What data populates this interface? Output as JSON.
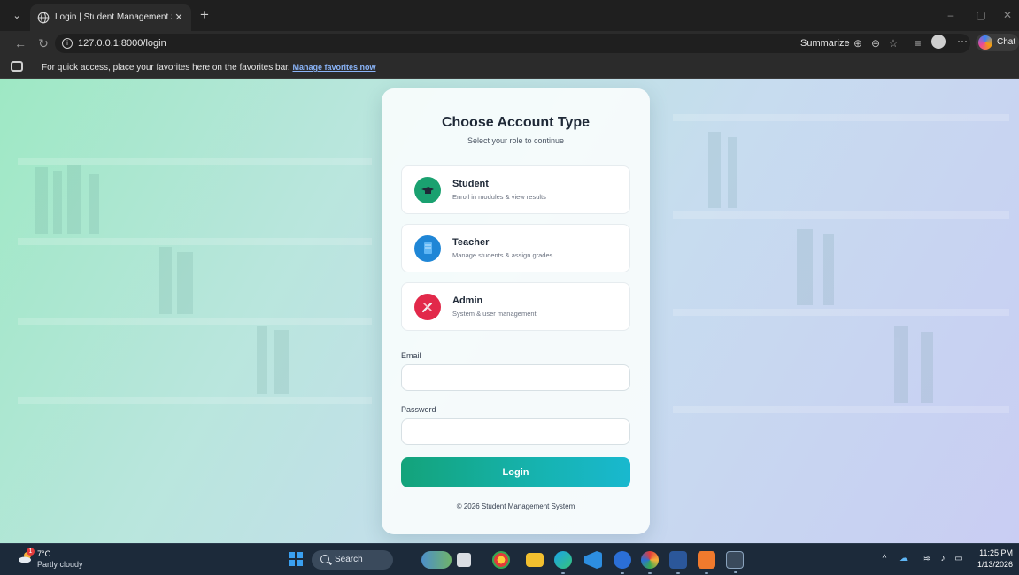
{
  "browser": {
    "tab_title": "Login | Student Management Syst",
    "tab_close": "✕",
    "new_tab": "+",
    "url": "127.0.0.1:8000/login",
    "summarize_label": "Summarize",
    "chat_label": "Chat",
    "favorites_text": "For quick access, place your favorites here on the favorites bar.",
    "favorites_link": "Manage favorites now",
    "theme_colors": {
      "chrome": "#2b2b2b",
      "tabbar": "#1f1f1f"
    }
  },
  "page": {
    "title": "Choose Account Type",
    "subtitle": "Select your role to continue",
    "roles": [
      {
        "name": "Student",
        "desc": "Enroll in modules & view results",
        "icon": "graduation-cap-icon",
        "color": "#1aa170"
      },
      {
        "name": "Teacher",
        "desc": "Manage students & assign grades",
        "icon": "book-icon",
        "color": "#1f86d6"
      },
      {
        "name": "Admin",
        "desc": "System & user management",
        "icon": "tools-icon",
        "color": "#e2294a"
      }
    ],
    "email_label": "Email",
    "email_value": "",
    "password_label": "Password",
    "password_value": "",
    "login_label": "Login",
    "footer": "© 2026 Student Management System",
    "accent_gradient": [
      "#13a37a",
      "#19b8cf"
    ]
  },
  "taskbar": {
    "weather_temp": "7°C",
    "weather_condition": "Partly cloudy",
    "weather_badge": "1",
    "search_label": "Search",
    "time": "11:25 PM",
    "date": "1/13/2026"
  }
}
